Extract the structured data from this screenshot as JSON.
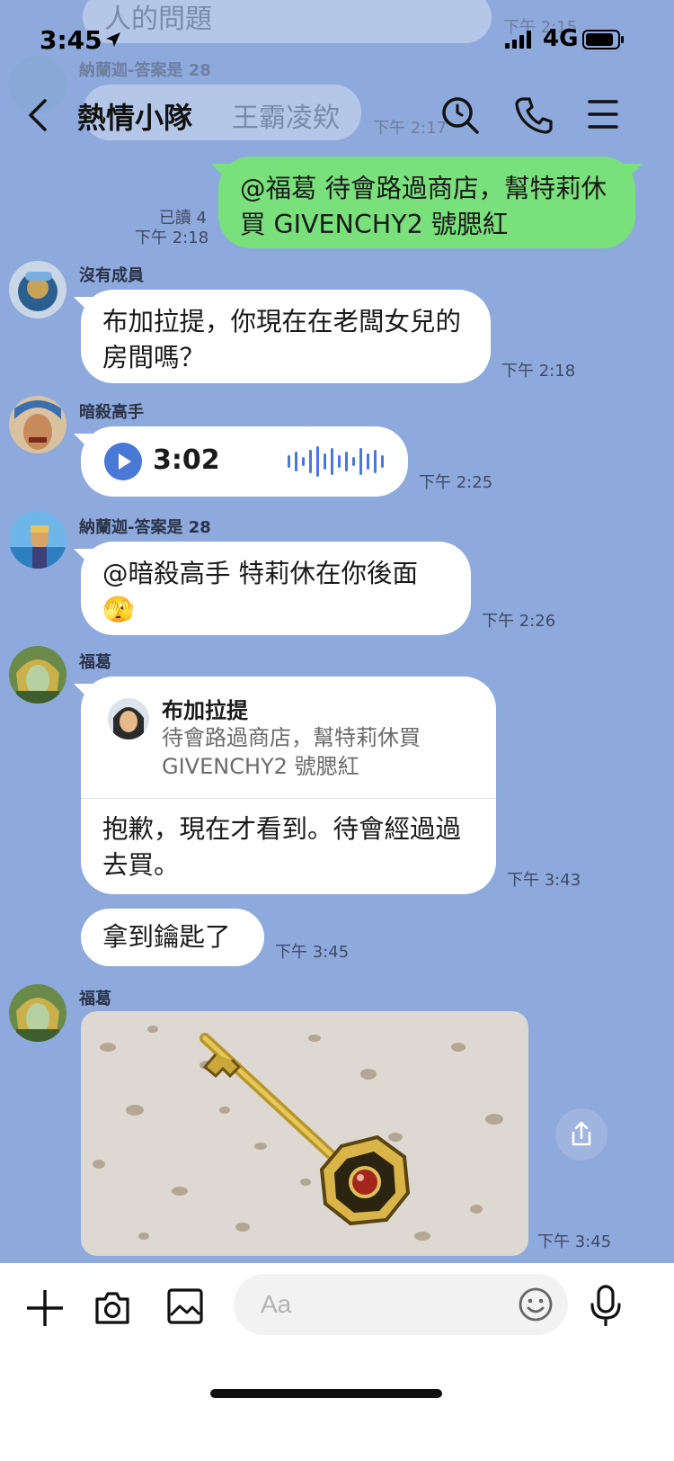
{
  "ghost": {
    "bubble1_text": "人的問題",
    "time1": "下午 2:15",
    "name": "納蘭迦-答案是 28",
    "bubble2_text": "王霸凌欸",
    "time2": "下午 2:17"
  },
  "status_bar": {
    "time": "3:45",
    "network": "4G"
  },
  "header": {
    "title": "熱情小隊"
  },
  "messages": [
    {
      "text": "@福葛 待會路過商店，幫特莉休買 GIVENCHY2 號腮紅",
      "read": "已讀 4",
      "time": "下午 2:18"
    },
    {
      "sender": "沒有成員",
      "text": "布加拉提，你現在在老闆女兒的房間嗎？",
      "time": "下午 2:18"
    },
    {
      "sender": "暗殺高手",
      "duration": "3:02",
      "time": "下午 2:25"
    },
    {
      "sender": "納蘭迦-答案是 28",
      "text": "@暗殺高手 特莉休在你後面",
      "emoji": "🫣",
      "time": "下午 2:26"
    },
    {
      "sender": "福葛",
      "reply_name": "布加拉提",
      "reply_text": "待會路過商店，幫特莉休買 GIVENCHY2 號腮紅",
      "text": "抱歉，現在才看到。待會經過過去買。",
      "time": "下午 3:43"
    },
    {
      "text": "拿到鑰匙了",
      "time": "下午 3:45"
    },
    {
      "sender": "福葛",
      "image": "golden-key-image",
      "time": "下午 3:45"
    }
  ],
  "input": {
    "placeholder": "Aa"
  },
  "colors": {
    "background": "#8ea9dc",
    "my_bubble": "#79e07c",
    "play_button": "#4a78d6"
  }
}
